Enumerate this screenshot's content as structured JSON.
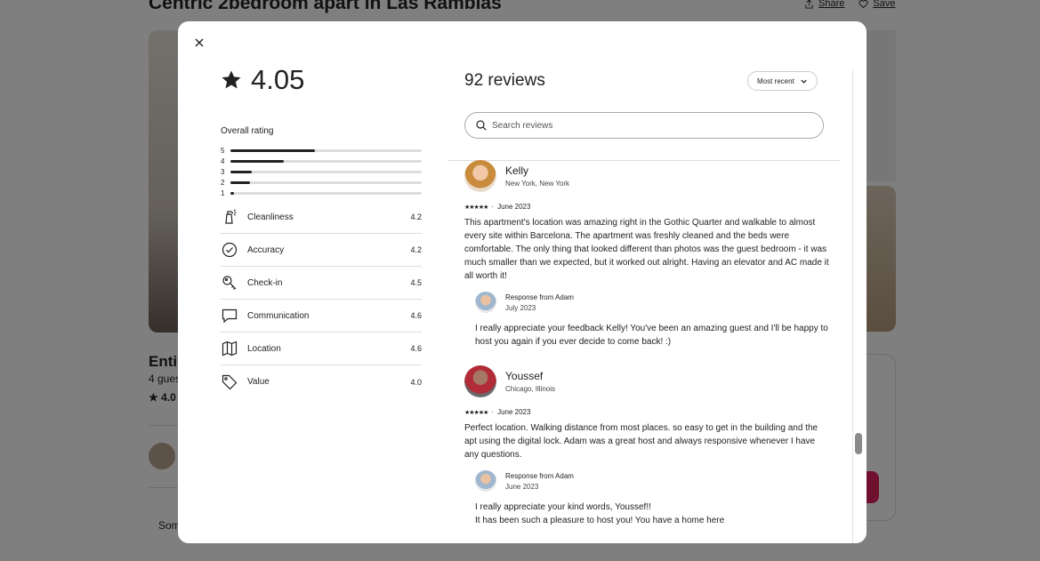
{
  "background": {
    "title": "Centric 2bedroom apart in Las Ramblas",
    "share_label": "Share",
    "save_label": "Save",
    "heading": "Entir",
    "guests": "4 gues",
    "rating": "★ 4.0",
    "some": "Som"
  },
  "modal": {
    "close_icon": "close-icon",
    "overall_score": "4.05",
    "overall_label": "Overall rating",
    "distribution": [
      {
        "stars": "5",
        "fraction": 0.44
      },
      {
        "stars": "4",
        "fraction": 0.28
      },
      {
        "stars": "3",
        "fraction": 0.11
      },
      {
        "stars": "2",
        "fraction": 0.1
      },
      {
        "stars": "1",
        "fraction": 0.02
      }
    ],
    "categories": [
      {
        "label": "Cleanliness",
        "value": "4.2",
        "icon": "spray-bottle-icon"
      },
      {
        "label": "Accuracy",
        "value": "4.2",
        "icon": "check-circle-icon"
      },
      {
        "label": "Check-in",
        "value": "4.5",
        "icon": "key-icon"
      },
      {
        "label": "Communication",
        "value": "4.6",
        "icon": "chat-bubble-icon"
      },
      {
        "label": "Location",
        "value": "4.6",
        "icon": "map-icon"
      },
      {
        "label": "Value",
        "value": "4.0",
        "icon": "tag-icon"
      }
    ],
    "reviews_count": "92 reviews",
    "sort_label": "Most recent",
    "search_placeholder": "Search reviews",
    "reviews": [
      {
        "name": "Kelly",
        "location": "New York, New York",
        "stars": "★★★★★",
        "date": "June 2023",
        "text": "This apartment's location was amazing right in the Gothic Quarter and walkable to almost every site within Barcelona. The apartment was freshly cleaned and the beds were comfortable. The only thing that looked different than photos was the guest bedroom - it was much smaller than we expected, but it worked out alright. Having an elevator and AC made it all worth it!",
        "response_from": "Response from Adam",
        "response_date": "July 2023",
        "response_text": "I really appreciate your feedback Kelly! You've been an amazing guest and I'll be happy to host you again if you ever decide to come back! :)"
      },
      {
        "name": "Youssef",
        "location": "Chicago, Illinois",
        "stars": "★★★★★",
        "date": "June 2023",
        "text": "Perfect location. Walking distance from most places. so easy to get in the building and the apt using the digital lock. Adam was a great host and always responsive whenever I have any questions.",
        "response_from": "Response from Adam",
        "response_date": "June 2023",
        "response_text": "I really appreciate your kind words, Youssef!!\nIt has been such a pleasure to host you! You have a home here"
      }
    ],
    "colors": {
      "overlay": "#000000",
      "text": "#222222",
      "divider": "#dddddd",
      "brand": "#e0215f"
    }
  }
}
